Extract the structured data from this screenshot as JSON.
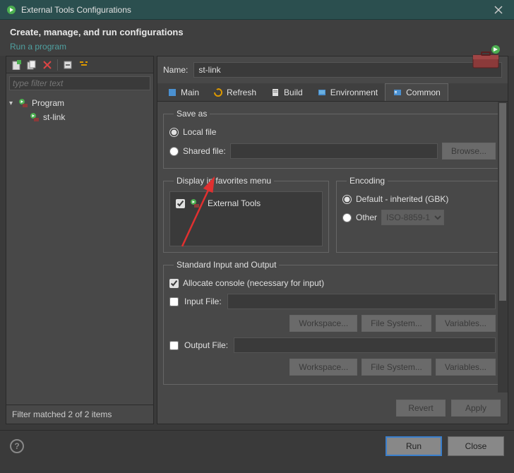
{
  "window": {
    "title": "External Tools Configurations"
  },
  "header": {
    "title": "Create, manage, and run configurations",
    "subtitle": "Run a program"
  },
  "filter": {
    "placeholder": "type filter text"
  },
  "tree": {
    "root": "Program",
    "child": "st-link"
  },
  "filterStatus": "Filter matched 2 of 2 items",
  "nameLabel": "Name:",
  "nameValue": "st-link",
  "tabs": {
    "main": "Main",
    "refresh": "Refresh",
    "build": "Build",
    "environment": "Environment",
    "common": "Common"
  },
  "saveAs": {
    "legend": "Save as",
    "local": "Local file",
    "shared": "Shared file:",
    "browse": "Browse..."
  },
  "favorites": {
    "legend": "Display in favorites menu",
    "external": "External Tools"
  },
  "encoding": {
    "legend": "Encoding",
    "default": "Default - inherited (GBK)",
    "other": "Other",
    "select": "ISO-8859-1"
  },
  "io": {
    "legend": "Standard Input and Output",
    "allocate": "Allocate console (necessary for input)",
    "inputFile": "Input File:",
    "outputFile": "Output File:",
    "workspace": "Workspace...",
    "fileSystem": "File System...",
    "variables": "Variables..."
  },
  "actions": {
    "revert": "Revert",
    "apply": "Apply",
    "run": "Run",
    "close": "Close"
  }
}
